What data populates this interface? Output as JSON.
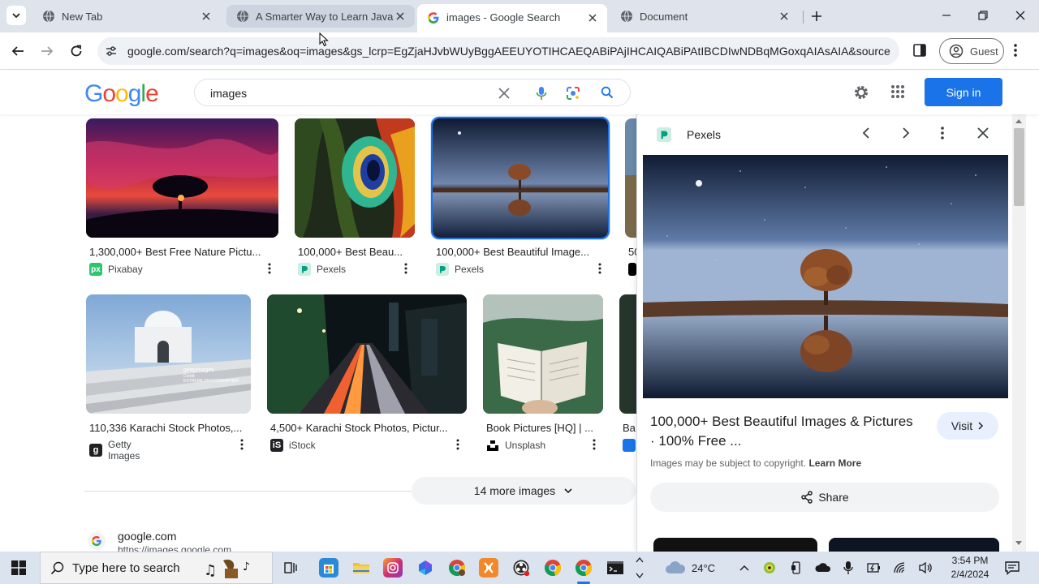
{
  "browser": {
    "tabs": [
      {
        "title": "New Tab",
        "active": false
      },
      {
        "title": "A Smarter Way to Learn JavaScript",
        "active": false
      },
      {
        "title": "images - Google Search",
        "active": true
      },
      {
        "title": "Document",
        "active": false
      }
    ],
    "url": "google.com/search?q=images&oq=images&gs_lcrp=EgZjaHJvbWUyBggAEEUYOTIHCAEQABiPAjIHCAIQABiPAtIBCDIwNDBqMGoxqAIAsAIA&sourceid...",
    "guest_label": "Guest"
  },
  "google": {
    "logo": "Google",
    "query": "images",
    "sign_in_label": "Sign in"
  },
  "results": [
    {
      "title": "1,300,000+ Best Free Nature Pictu...",
      "source": "Pixabay"
    },
    {
      "title": "100,000+ Best Beau...",
      "source": "Pexels"
    },
    {
      "title": "100,000+ Best Beautiful Image...",
      "source": "Pexels"
    },
    {
      "title": "50",
      "source": ""
    },
    {
      "title": "110,336 Karachi Stock Photos,...",
      "source": "Getty Images"
    },
    {
      "title": "4,500+ Karachi Stock Photos, Pictur...",
      "source": "iStock"
    },
    {
      "title": "Book Pictures [HQ] | ...",
      "source": "Unsplash"
    },
    {
      "title": "Ba",
      "source": ""
    }
  ],
  "thumb_watermark": {
    "line1": "gettyimages",
    "line2": "Credit:",
    "line3": "EXTREME PHOTOGRAPHER"
  },
  "more_images_label": "14 more images",
  "next_result": {
    "title": "google.com",
    "url": "https://images.google.com"
  },
  "panel": {
    "source_name": "Pexels",
    "title": "100,000+ Best Beautiful Images & Pictures · 100% Free ...",
    "visit_label": "Visit",
    "copyright_text": "Images may be subject to copyright.",
    "learn_more_label": "Learn More",
    "share_label": "Share"
  },
  "taskbar": {
    "search_placeholder": "Type here to search",
    "weather": "24°C",
    "time": "3:54 PM",
    "date": "2/4/2024"
  },
  "colors": {
    "accent": "#1a73e8",
    "tabstrip_bg": "#dfe3eb",
    "omnibox_bg": "#eef1f6",
    "taskbar_bg": "#dbe3ef",
    "pexels_green": "#05a081",
    "pixabay_green": "#2ec66d"
  }
}
